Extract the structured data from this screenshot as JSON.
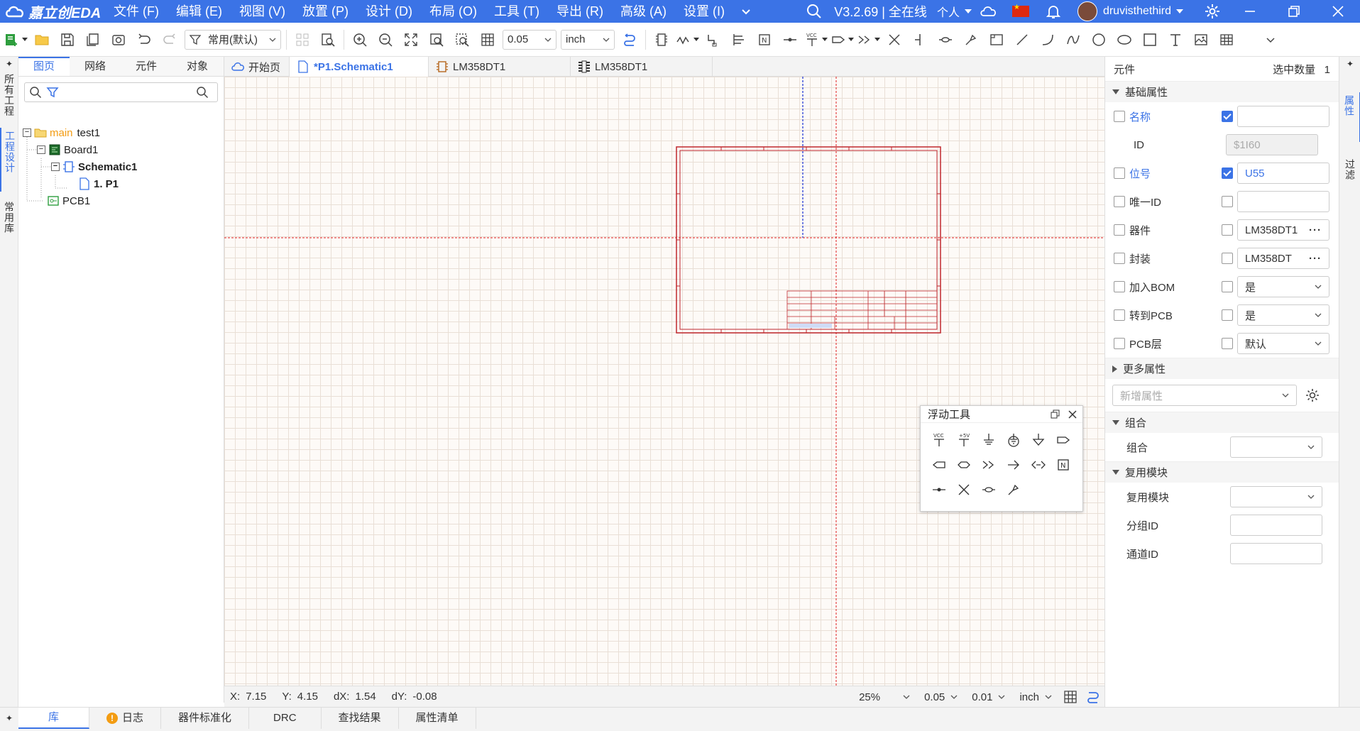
{
  "app": {
    "logo_text": "嘉立创EDA"
  },
  "menu": [
    "文件 (F)",
    "编辑 (E)",
    "视图 (V)",
    "放置 (P)",
    "设计 (D)",
    "布局 (O)",
    "工具 (T)",
    "导出 (R)",
    "高级 (A)",
    "设置 (I)"
  ],
  "titlebar": {
    "version": "V3.2.69 | 全在线",
    "mode": "个人",
    "username": "druvisthethird"
  },
  "toolbar": {
    "filter_label": "常用(默认)",
    "grid_value": "0.05",
    "unit": "inch"
  },
  "left_strip": {
    "tabs": [
      "所有工程",
      "工程设计",
      "常用库"
    ]
  },
  "left_panel": {
    "tabs": [
      "图页",
      "网络",
      "元件",
      "对象"
    ],
    "search_placeholder": "",
    "tree": {
      "main_tag": "main",
      "project": "test1",
      "board": "Board1",
      "schematic": "Schematic1",
      "page": "1. P1",
      "pcb": "PCB1"
    }
  },
  "doc_tabs": [
    "开始页",
    "*P1.Schematic1",
    "LM358DT1",
    "LM358DT1"
  ],
  "floating_tool": {
    "title": "浮动工具"
  },
  "status": {
    "x_label": "X:",
    "x": "7.15",
    "y_label": "Y:",
    "y": "4.15",
    "dx_label": "dX:",
    "dx": "1.54",
    "dy_label": "dY:",
    "dy": "-0.08",
    "zoom": "25%",
    "grid": "0.05",
    "snap": "0.01",
    "unit": "inch"
  },
  "bottom_tabs": [
    "库",
    "日志",
    "器件标准化",
    "DRC",
    "查找结果",
    "属性清单"
  ],
  "right_panel": {
    "header": "元件",
    "selected_label": "选中数量",
    "selected_count": "1",
    "sections": {
      "basic": "基础属性",
      "more": "更多属性",
      "group": "组合",
      "reuse": "复用模块"
    },
    "props": {
      "name": {
        "label": "名称",
        "value": ""
      },
      "id": {
        "label": "ID",
        "value": "$1I60"
      },
      "designator": {
        "label": "位号",
        "value": "U55"
      },
      "unique_id": {
        "label": "唯一ID",
        "value": ""
      },
      "device": {
        "label": "器件",
        "value": "LM358DT1"
      },
      "footprint": {
        "label": "封装",
        "value": "LM358DT"
      },
      "add_bom": {
        "label": "加入BOM",
        "value": "是"
      },
      "to_pcb": {
        "label": "转到PCB",
        "value": "是"
      },
      "pcb_layer": {
        "label": "PCB层",
        "value": "默认"
      }
    },
    "add_prop_placeholder": "新增属性",
    "group_label": "组合",
    "reuse_label": "复用模块",
    "group_id_label": "分组ID",
    "channel_id_label": "通道ID"
  },
  "right_strip": {
    "tabs": [
      "属性",
      "过滤"
    ]
  },
  "colors": {
    "brand": "#3b73e6",
    "schematic_frame": "#c0272d",
    "crosshair": "#e02020"
  }
}
